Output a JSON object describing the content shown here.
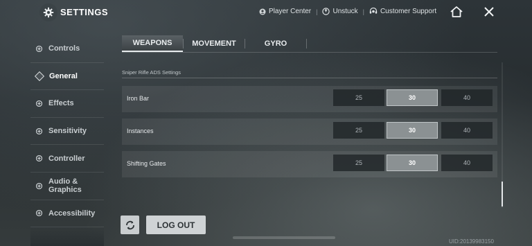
{
  "header": {
    "title": "SETTINGS",
    "links": [
      {
        "label": "Player Center",
        "icon": "player-center-icon"
      },
      {
        "label": "Unstuck",
        "icon": "unstuck-icon"
      },
      {
        "label": "Customer Support",
        "icon": "support-icon"
      }
    ],
    "home_icon": "home-icon",
    "close_icon": "close-icon"
  },
  "sidebar": {
    "items": [
      {
        "label": "Controls",
        "active": false
      },
      {
        "label": "General",
        "active": true
      },
      {
        "label": "Effects",
        "active": false
      },
      {
        "label": "Sensitivity",
        "active": false
      },
      {
        "label": "Controller",
        "active": false
      },
      {
        "label": "Audio & Graphics",
        "active": false
      },
      {
        "label": "Accessibility",
        "active": false
      }
    ]
  },
  "tabs": [
    {
      "label": "WEAPONS",
      "active": true
    },
    {
      "label": "MOVEMENT",
      "active": false
    },
    {
      "label": "GYRO",
      "active": false
    }
  ],
  "section": {
    "label": "Sniper Rifle ADS Settings"
  },
  "rows": [
    {
      "label": "Iron Bar",
      "options": [
        "25",
        "30",
        "40"
      ],
      "selected": "30"
    },
    {
      "label": "Instances",
      "options": [
        "25",
        "30",
        "40"
      ],
      "selected": "30"
    },
    {
      "label": "Shifting Gates",
      "options": [
        "25",
        "30",
        "40"
      ],
      "selected": "30"
    }
  ],
  "footer": {
    "logout_label": "LOG OUT",
    "uid": "UID:20139983150"
  },
  "colors": {
    "selected_option": "#8b9193",
    "button_bg": "#cfd3d5"
  }
}
